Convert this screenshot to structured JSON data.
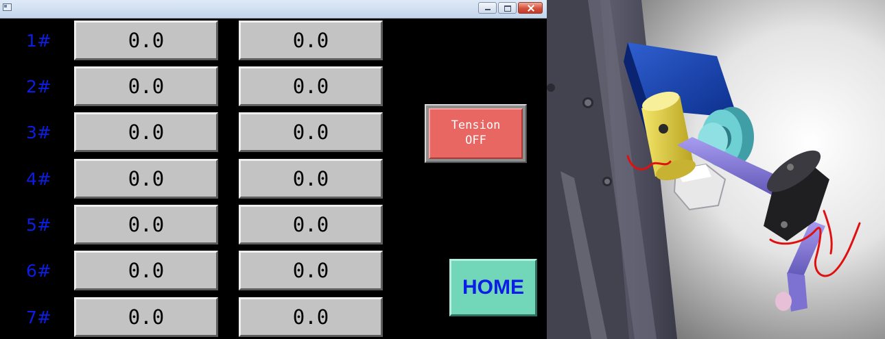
{
  "hmi": {
    "rows": [
      {
        "label": "1#",
        "value_a": "0.0",
        "value_b": "0.0"
      },
      {
        "label": "2#",
        "value_a": "0.0",
        "value_b": "0.0"
      },
      {
        "label": "3#",
        "value_a": "0.0",
        "value_b": "0.0"
      },
      {
        "label": "4#",
        "value_a": "0.0",
        "value_b": "0.0"
      },
      {
        "label": "5#",
        "value_a": "0.0",
        "value_b": "0.0"
      },
      {
        "label": "6#",
        "value_a": "0.0",
        "value_b": "0.0"
      },
      {
        "label": "7#",
        "value_a": "0.0",
        "value_b": "0.0"
      }
    ],
    "tension_button": {
      "line1": "Tension",
      "line2": "OFF"
    },
    "home_button": "HOME"
  },
  "icons": {
    "app": "app-window-icon",
    "minimize": "minimize-icon",
    "maximize": "maximize-icon",
    "close": "close-icon"
  },
  "colors": {
    "background": "#000000",
    "row_label": "#0a1ee6",
    "value_button": "#c3c3c3",
    "tension_off": "#e86763",
    "home_button": "#72d6b9",
    "home_text": "#0a1ee6",
    "annotation": "#e01010"
  }
}
